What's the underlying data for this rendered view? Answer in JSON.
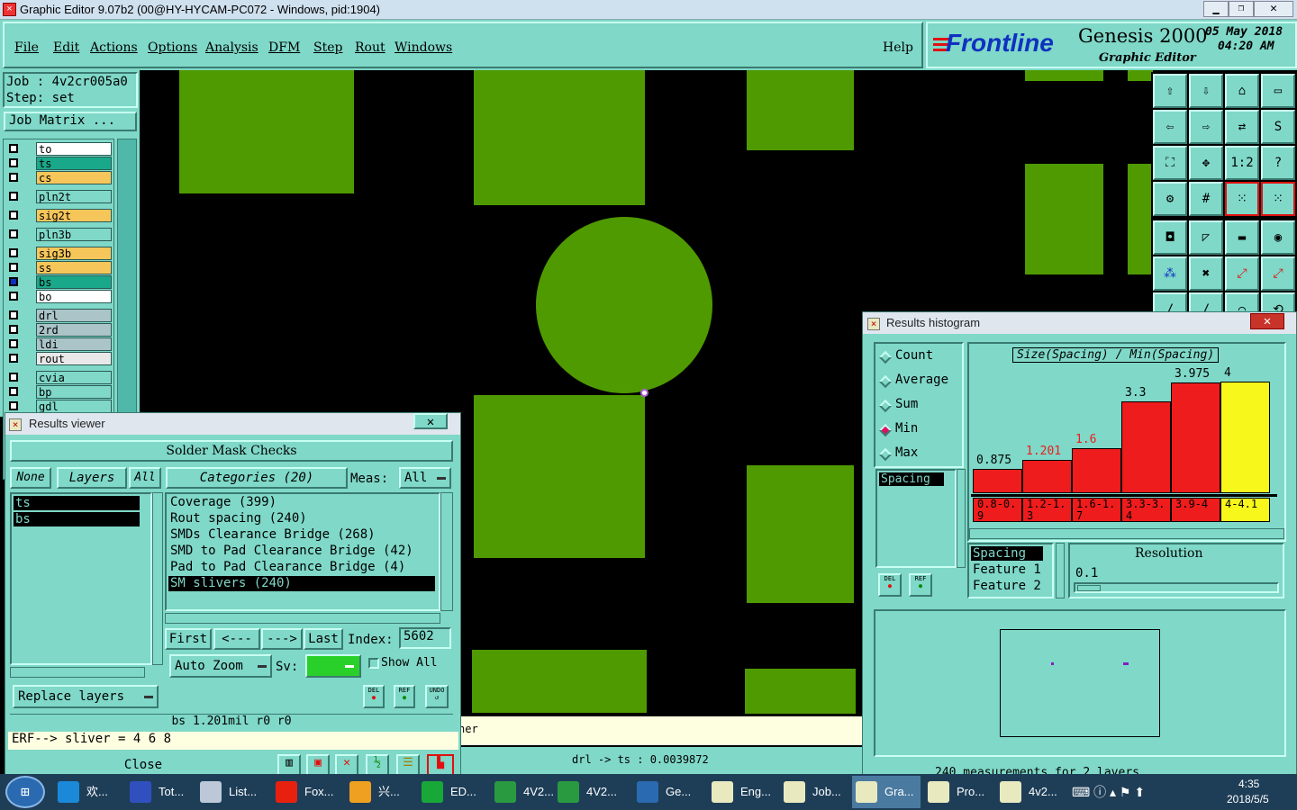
{
  "window_title": "Graphic Editor 9.07b2 (00@HY-HYCAM-PC072 - Windows, pid:1904)",
  "menu": [
    "File",
    "Edit",
    "Actions",
    "Options",
    "Analysis",
    "DFM",
    "Step",
    "Rout",
    "Windows"
  ],
  "help": "Help",
  "brand": {
    "logo": "Frontline",
    "product": "Genesis 2000",
    "subtitle": "Graphic Editor",
    "date": "05 May 2018",
    "time": "04:20 AM"
  },
  "job": {
    "job_label": "Job : 4v2cr005a0",
    "step_label": "Step: set",
    "job_matrix": "Job Matrix ..."
  },
  "layers": [
    {
      "name": "to",
      "color": "#ffffff"
    },
    {
      "name": "ts",
      "color": "#1aa88a"
    },
    {
      "name": "cs",
      "color": "#f7c65a"
    },
    {
      "name": "pln2t",
      "color": "#7fd8c8"
    },
    {
      "name": "sig2t",
      "color": "#f7c65a"
    },
    {
      "name": "pln3b",
      "color": "#7fd8c8"
    },
    {
      "name": "sig3b",
      "color": "#f7c65a"
    },
    {
      "name": "ss",
      "color": "#f7c65a"
    },
    {
      "name": "bs",
      "color": "#1aa88a"
    },
    {
      "name": "bo",
      "color": "#ffffff"
    },
    {
      "name": "drl",
      "color": "#aac4c8"
    },
    {
      "name": "2rd",
      "color": "#aac4c8"
    },
    {
      "name": "ldi",
      "color": "#aac4c8"
    },
    {
      "name": "rout",
      "color": "#e8e8e8"
    },
    {
      "name": "cvia",
      "color": "#7fd8c8"
    },
    {
      "name": "bp",
      "color": "#7fd8c8"
    },
    {
      "name": "gdl",
      "color": "#7fd8c8"
    }
  ],
  "results_viewer": {
    "title": "Results viewer",
    "header": "Solder Mask Checks",
    "btn_none": "None",
    "btn_layers": "Layers",
    "btn_all": "All",
    "categories_btn": "Categories (20)",
    "meas_label": "Meas:",
    "meas_value": "All",
    "layer_list": [
      "ts",
      "bs"
    ],
    "categories": [
      "Coverage (399)",
      "Rout spacing (240)",
      "SMDs Clearance Bridge (268)",
      "SMD to Pad Clearance Bridge (42)",
      "Pad to Pad Clearance Bridge (4)",
      "SM slivers (240)"
    ],
    "nav": {
      "first": "First",
      "prev": "<---",
      "next": "--->",
      "last": "Last",
      "index_label": "Index:",
      "index_value": "5602"
    },
    "auto_zoom": "Auto Zoom",
    "sv_label": "Sv:",
    "show_all": "Show All",
    "replace_layers": "Replace layers",
    "status": "bs 1.201mil   r0   r0",
    "erf": "ERF--> sliver = 4 6 8",
    "close": "Close",
    "del": "DEL",
    "ref": "REF",
    "undo": "UNDO"
  },
  "status_right": "drl -> ts : 0.0039872",
  "status_partial": "ner",
  "histogram": {
    "title": "Results histogram",
    "modes": [
      "Count",
      "Average",
      "Sum",
      "Min",
      "Max"
    ],
    "selected_mode": "Min",
    "chart_title": "Size(Spacing) / Min(Spacing)",
    "measure": "Spacing",
    "bars": [
      {
        "value": "0.875",
        "range": "0.8-0.9",
        "label_color": "#000000"
      },
      {
        "value": "1.201",
        "range": "1.2-1.3",
        "label_color": "#ee1c1c"
      },
      {
        "value": "1.6",
        "range": "1.6-1.7",
        "label_color": "#ee1c1c"
      },
      {
        "value": "3.3",
        "range": "3.3-3.4",
        "label_color": "#000000"
      },
      {
        "value": "3.975",
        "range": "3.9-4",
        "label_color": "#000000"
      },
      {
        "value": "4",
        "range": "4-4.1",
        "label_color": "#000000"
      }
    ],
    "fields": [
      "Spacing",
      "Feature 1",
      "Feature 2"
    ],
    "resolution_label": "Resolution",
    "resolution_value": "0.1",
    "footer": "240 measurements for 2 layers",
    "del": "DEL",
    "ref": "REF"
  },
  "chart_data": {
    "type": "bar",
    "title": "Size(Spacing) / Min(Spacing)",
    "categories": [
      "0.8-0.9",
      "1.2-1.3",
      "1.6-1.7",
      "3.3-3.4",
      "3.9-4",
      "4-4.1"
    ],
    "values": [
      0.875,
      1.201,
      1.6,
      3.3,
      3.975,
      4
    ],
    "ylim": [
      0,
      4
    ],
    "colors": [
      "#ee1c1c",
      "#ee1c1c",
      "#ee1c1c",
      "#ee1c1c",
      "#ee1c1c",
      "#f7f71c"
    ]
  },
  "taskbar": {
    "items": [
      "欢...",
      "Tot...",
      "List...",
      "Fox...",
      "兴...",
      "ED...",
      "4V2...",
      "4V2...",
      "Ge...",
      "Eng...",
      "Job...",
      "Gra...",
      "Pro...",
      "4v2..."
    ],
    "clock_time": "4:35",
    "clock_date": "2018/5/5"
  }
}
